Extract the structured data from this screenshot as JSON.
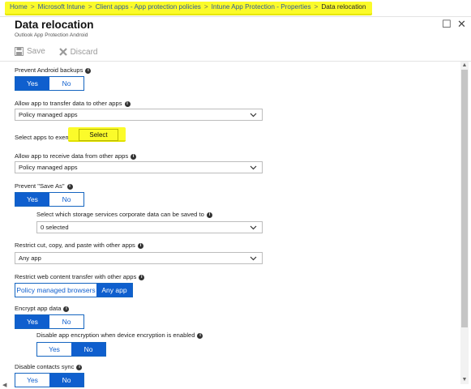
{
  "breadcrumb": [
    "Home",
    "Microsoft Intune",
    "Client apps - App protection policies",
    "Intune App Protection - Properties",
    "Data relocation"
  ],
  "title": "Data relocation",
  "subtitle": "Outlook App Protection Android",
  "toolbar": {
    "save_label": "Save",
    "discard_label": "Discard"
  },
  "settings": {
    "prevent_backups": {
      "label": "Prevent Android backups",
      "yes": "Yes",
      "no": "No"
    },
    "transfer_data": {
      "label": "Allow app to transfer data to other apps",
      "value": "Policy managed apps"
    },
    "exempt": {
      "label": "Select apps to exempt",
      "button": "Select"
    },
    "receive_data": {
      "label": "Allow app to receive data from other apps",
      "value": "Policy managed apps"
    },
    "prevent_save_as": {
      "label": "Prevent \"Save As\"",
      "yes": "Yes",
      "no": "No"
    },
    "storage_services": {
      "label": "Select which storage services corporate data can be saved to",
      "value": "0 selected"
    },
    "cut_copy_paste": {
      "label": "Restrict cut, copy, and paste with other apps",
      "value": "Any app"
    },
    "web_content": {
      "label": "Restrict web content transfer with other apps",
      "opt1": "Policy managed browsers",
      "opt2": "Any app"
    },
    "encrypt": {
      "label": "Encrypt app data",
      "yes": "Yes",
      "no": "No"
    },
    "disable_encryption": {
      "label": "Disable app encryption when device encryption is enabled",
      "yes": "Yes",
      "no": "No"
    },
    "contacts_sync": {
      "label": "Disable contacts sync",
      "yes": "Yes",
      "no": "No"
    }
  },
  "colors": {
    "accent": "#0f5fce",
    "highlight": "#fbfb2a"
  }
}
